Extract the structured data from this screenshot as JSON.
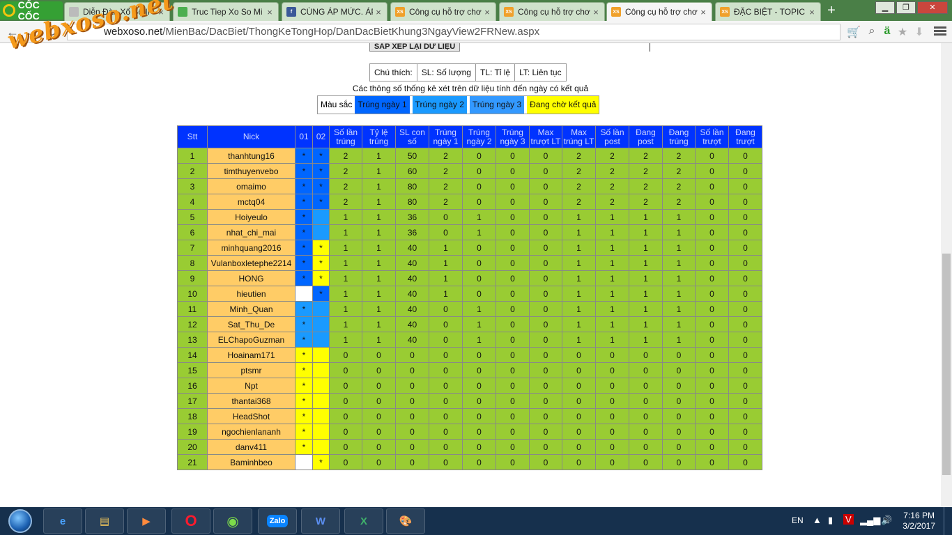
{
  "browser": {
    "brand": "CỐC CỐC",
    "tabs": [
      {
        "title": "Diễn Đàn Xổ Số IF",
        "icon": "page-icon",
        "active": false
      },
      {
        "title": "Truc Tiep Xo So Mi",
        "icon": "globe-icon",
        "active": false
      },
      {
        "title": "CÙNG ÁP MỨC. ÁP",
        "icon": "facebook-icon",
        "active": false
      },
      {
        "title": "Công cụ hỗ trợ chơ",
        "icon": "xs-icon",
        "active": false
      },
      {
        "title": "Công cụ hỗ trợ chơ",
        "icon": "xs-icon",
        "active": false
      },
      {
        "title": "Công cụ hỗ trợ chơ",
        "icon": "xs-icon",
        "active": true
      },
      {
        "title": "ĐẶC BIỆT - TOPIC Đ",
        "icon": "xs-icon",
        "active": false
      }
    ],
    "url_host": "webxoso.net",
    "url_path": "/MienBac/DacBiet/ThongKeTongHop/DanDacBietKhung3NgayView2FRNew.aspx",
    "watermark": "webxoso.net"
  },
  "page": {
    "sort_button": "SẮP XẾP LẠI DỮ LIỆU",
    "legend": [
      "Chú thích:",
      "SL: Số lượng",
      "TL: Tỉ lệ",
      "LT: Liên tục"
    ],
    "note": "Các thông số thống kê xét trên dữ liệu tính đến ngày có kết quả",
    "colors_label": "Màu sắc",
    "colors": [
      {
        "label": "Trúng ngày 1",
        "color": "#0066ff"
      },
      {
        "label": "Trúng ngày 2",
        "color": "#1a9aff"
      },
      {
        "label": "Trúng ngày 3",
        "color": "#3399ff"
      },
      {
        "label": "Đang chờ kết quả",
        "color": "#ffff00"
      }
    ],
    "table": {
      "headers": [
        "Stt",
        "Nick",
        "01",
        "02",
        "Số lần trúng",
        "Tỷ lệ trúng",
        "SL con số",
        "Trúng ngày 1",
        "Trúng ngày 2",
        "Trúng ngày 3",
        "Max trượt LT",
        "Max trúng LT",
        "Số lần post",
        "Đang post",
        "Đang trúng",
        "Số lần trượt",
        "Đang trượt"
      ],
      "rows": [
        {
          "stt": "1",
          "nick": "thanhtung16",
          "d1": "*",
          "d1s": "c1",
          "d2": "*",
          "d2s": "c1",
          "vals": [
            "2",
            "1",
            "50",
            "2",
            "0",
            "0",
            "0",
            "2",
            "2",
            "2",
            "2",
            "0",
            "0"
          ]
        },
        {
          "stt": "2",
          "nick": "timthuyenvebo",
          "d1": "*",
          "d1s": "c1",
          "d2": "*",
          "d2s": "c1",
          "vals": [
            "2",
            "1",
            "60",
            "2",
            "0",
            "0",
            "0",
            "2",
            "2",
            "2",
            "2",
            "0",
            "0"
          ]
        },
        {
          "stt": "3",
          "nick": "omaimo",
          "d1": "*",
          "d1s": "c1",
          "d2": "*",
          "d2s": "c1",
          "vals": [
            "2",
            "1",
            "80",
            "2",
            "0",
            "0",
            "0",
            "2",
            "2",
            "2",
            "2",
            "0",
            "0"
          ]
        },
        {
          "stt": "4",
          "nick": "mctq04",
          "d1": "*",
          "d1s": "c1",
          "d2": "*",
          "d2s": "c1",
          "vals": [
            "2",
            "1",
            "80",
            "2",
            "0",
            "0",
            "0",
            "2",
            "2",
            "2",
            "2",
            "0",
            "0"
          ]
        },
        {
          "stt": "5",
          "nick": "Hoiyeulo",
          "d1": "*",
          "d1s": "c1",
          "d2": "",
          "d2s": "c2",
          "vals": [
            "1",
            "1",
            "36",
            "0",
            "1",
            "0",
            "0",
            "1",
            "1",
            "1",
            "1",
            "0",
            "0"
          ]
        },
        {
          "stt": "6",
          "nick": "nhat_chi_mai",
          "d1": "*",
          "d1s": "c1",
          "d2": "",
          "d2s": "c2",
          "vals": [
            "1",
            "1",
            "36",
            "0",
            "1",
            "0",
            "0",
            "1",
            "1",
            "1",
            "1",
            "0",
            "0"
          ]
        },
        {
          "stt": "7",
          "nick": "minhquang2016",
          "d1": "*",
          "d1s": "c1",
          "d2": "*",
          "d2s": "cy",
          "vals": [
            "1",
            "1",
            "40",
            "1",
            "0",
            "0",
            "0",
            "1",
            "1",
            "1",
            "1",
            "0",
            "0"
          ]
        },
        {
          "stt": "8",
          "nick": "Vulanboxletephe2214",
          "d1": "*",
          "d1s": "c1",
          "d2": "*",
          "d2s": "cy",
          "vals": [
            "1",
            "1",
            "40",
            "1",
            "0",
            "0",
            "0",
            "1",
            "1",
            "1",
            "1",
            "0",
            "0"
          ]
        },
        {
          "stt": "9",
          "nick": "HONG",
          "d1": "*",
          "d1s": "c1",
          "d2": "*",
          "d2s": "cy",
          "vals": [
            "1",
            "1",
            "40",
            "1",
            "0",
            "0",
            "0",
            "1",
            "1",
            "1",
            "1",
            "0",
            "0"
          ]
        },
        {
          "stt": "10",
          "nick": "hieutien",
          "d1": "",
          "d1s": "cw",
          "d2": "*",
          "d2s": "c1",
          "vals": [
            "1",
            "1",
            "40",
            "1",
            "0",
            "0",
            "0",
            "1",
            "1",
            "1",
            "1",
            "0",
            "0"
          ]
        },
        {
          "stt": "11",
          "nick": "Minh_Quan",
          "d1": "*",
          "d1s": "c2",
          "d2": "",
          "d2s": "c2",
          "vals": [
            "1",
            "1",
            "40",
            "0",
            "1",
            "0",
            "0",
            "1",
            "1",
            "1",
            "1",
            "0",
            "0"
          ]
        },
        {
          "stt": "12",
          "nick": "Sat_Thu_De",
          "d1": "*",
          "d1s": "c2",
          "d2": "",
          "d2s": "c2",
          "vals": [
            "1",
            "1",
            "40",
            "0",
            "1",
            "0",
            "0",
            "1",
            "1",
            "1",
            "1",
            "0",
            "0"
          ]
        },
        {
          "stt": "13",
          "nick": "ELChapoGuzman",
          "d1": "*",
          "d1s": "c2",
          "d2": "",
          "d2s": "c2",
          "vals": [
            "1",
            "1",
            "40",
            "0",
            "1",
            "0",
            "0",
            "1",
            "1",
            "1",
            "1",
            "0",
            "0"
          ]
        },
        {
          "stt": "14",
          "nick": "Hoainam171",
          "d1": "*",
          "d1s": "cy",
          "d2": "",
          "d2s": "cy",
          "vals": [
            "0",
            "0",
            "0",
            "0",
            "0",
            "0",
            "0",
            "0",
            "0",
            "0",
            "0",
            "0",
            "0"
          ]
        },
        {
          "stt": "15",
          "nick": "ptsmr",
          "d1": "*",
          "d1s": "cy",
          "d2": "",
          "d2s": "cy",
          "vals": [
            "0",
            "0",
            "0",
            "0",
            "0",
            "0",
            "0",
            "0",
            "0",
            "0",
            "0",
            "0",
            "0"
          ]
        },
        {
          "stt": "16",
          "nick": "Npt",
          "d1": "*",
          "d1s": "cy",
          "d2": "",
          "d2s": "cy",
          "vals": [
            "0",
            "0",
            "0",
            "0",
            "0",
            "0",
            "0",
            "0",
            "0",
            "0",
            "0",
            "0",
            "0"
          ]
        },
        {
          "stt": "17",
          "nick": "thantai368",
          "d1": "*",
          "d1s": "cy",
          "d2": "",
          "d2s": "cy",
          "vals": [
            "0",
            "0",
            "0",
            "0",
            "0",
            "0",
            "0",
            "0",
            "0",
            "0",
            "0",
            "0",
            "0"
          ]
        },
        {
          "stt": "18",
          "nick": "HeadShot",
          "d1": "*",
          "d1s": "cy",
          "d2": "",
          "d2s": "cy",
          "vals": [
            "0",
            "0",
            "0",
            "0",
            "0",
            "0",
            "0",
            "0",
            "0",
            "0",
            "0",
            "0",
            "0"
          ]
        },
        {
          "stt": "19",
          "nick": "ngochienlananh",
          "d1": "*",
          "d1s": "cy",
          "d2": "",
          "d2s": "cy",
          "vals": [
            "0",
            "0",
            "0",
            "0",
            "0",
            "0",
            "0",
            "0",
            "0",
            "0",
            "0",
            "0",
            "0"
          ]
        },
        {
          "stt": "20",
          "nick": "danv411",
          "d1": "*",
          "d1s": "cy",
          "d2": "",
          "d2s": "cy",
          "vals": [
            "0",
            "0",
            "0",
            "0",
            "0",
            "0",
            "0",
            "0",
            "0",
            "0",
            "0",
            "0",
            "0"
          ]
        },
        {
          "stt": "21",
          "nick": "Baminhbeo",
          "d1": "",
          "d1s": "cw",
          "d2": "*",
          "d2s": "cy",
          "vals": [
            "0",
            "0",
            "0",
            "0",
            "0",
            "0",
            "0",
            "0",
            "0",
            "0",
            "0",
            "0",
            "0"
          ]
        }
      ]
    }
  },
  "taskbar": {
    "apps": [
      "Internet Explorer",
      "File Explorer",
      "Media Player",
      "Opera",
      "Cốc Cốc",
      "Zalo",
      "Word",
      "Excel",
      "Paint"
    ],
    "zalo_label": "Zalo",
    "lang": "EN",
    "time": "7:16 PM",
    "date": "3/2/2017"
  }
}
